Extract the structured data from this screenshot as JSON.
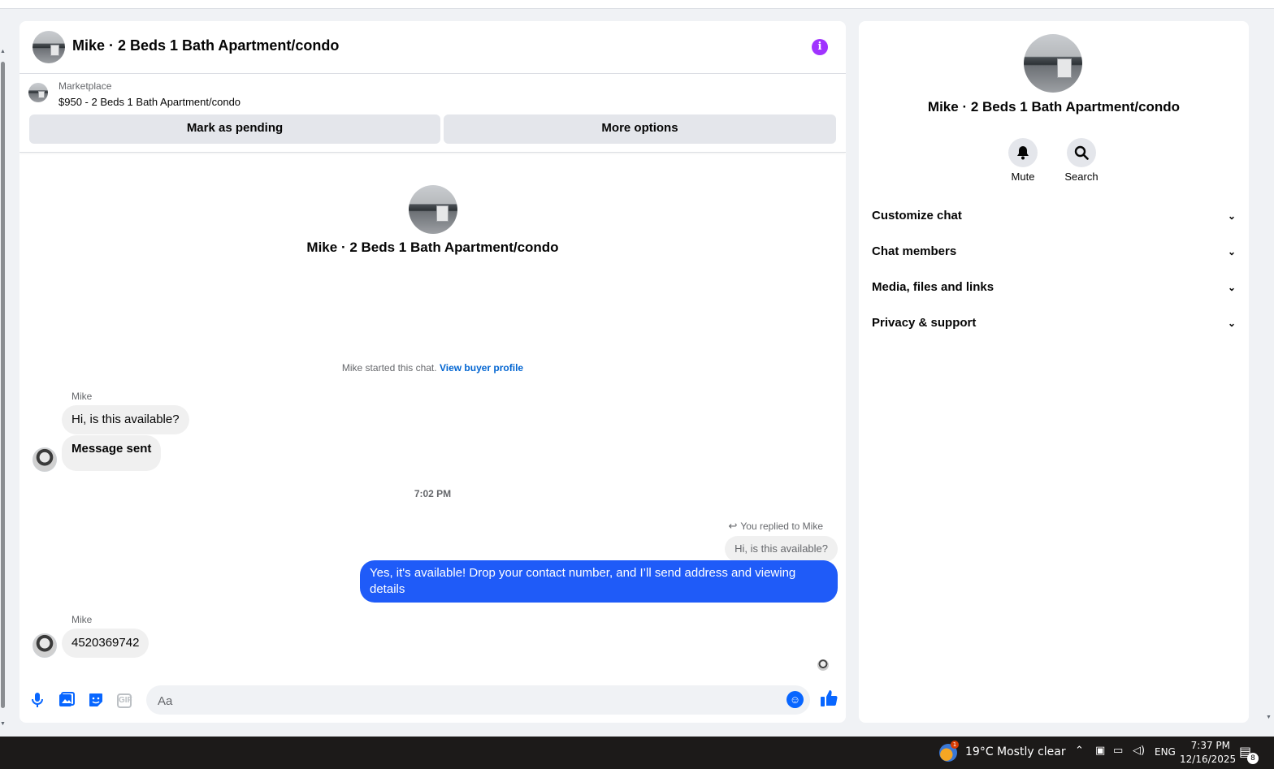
{
  "chat": {
    "header_title": "Mike · 2 Beds 1 Bath Apartment/condo",
    "info_icon": "info-icon",
    "marketplace": {
      "label": "Marketplace",
      "listing": "$950 - 2 Beds 1 Bath Apartment/condo",
      "mark_pending": "Mark as pending",
      "more_options": "More options"
    },
    "center_title": "Mike · 2 Beds 1 Bath Apartment/condo",
    "started_text": "Mike started this chat.",
    "view_buyer_profile": "View buyer profile",
    "messages": [
      {
        "sender": "Mike",
        "text": "Hi, is this available?"
      },
      {
        "text": "Message sent"
      }
    ],
    "timestamp": "7:02 PM",
    "reply_note": "You replied to Mike",
    "quoted": "Hi, is this available?",
    "outgoing": "Yes, it's available! Drop your contact number, and I’ll send address and viewing details",
    "last": {
      "sender": "Mike",
      "text": "4520369742"
    },
    "composer": {
      "placeholder": "Aa"
    }
  },
  "side": {
    "title": "Mike · 2 Beds 1 Bath Apartment/condo",
    "actions": [
      {
        "label": "Mute",
        "icon": "bell-icon"
      },
      {
        "label": "Search",
        "icon": "search-icon"
      }
    ],
    "sections": [
      "Customize chat",
      "Chat members",
      "Media, files and links",
      "Privacy & support"
    ]
  },
  "taskbar": {
    "weather": "19°C  Mostly clear",
    "weather_badge": "1",
    "language": "ENG",
    "time": "7:37 PM",
    "date": "12/16/2025",
    "notifications": "8"
  },
  "colors": {
    "accent": "#0866ff",
    "outgoing_bubble": "#1f5bf8",
    "info": "#a033ff"
  }
}
